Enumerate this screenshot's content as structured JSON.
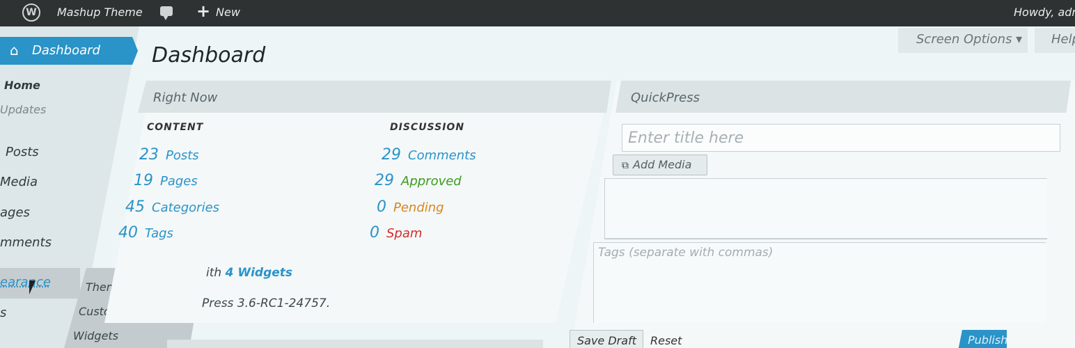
{
  "admin_bar": {
    "site_name": "Mashup Theme",
    "new_label": "New",
    "greeting": "Howdy, adm"
  },
  "sidebar": {
    "dashboard_label": "Dashboard",
    "submenu": [
      "Home",
      "Updates"
    ],
    "items": [
      "Posts",
      "Media",
      "ages",
      "mments",
      "earance",
      "s"
    ],
    "flyout": [
      "Themes",
      "Customize",
      "Widgets"
    ]
  },
  "screen_options": "Screen Options ▾",
  "help": "Help",
  "page_title": "Dashboard",
  "right_now": {
    "title": "Right Now",
    "content_heading": "CONTENT",
    "discussion_heading": "DISCUSSION",
    "content": [
      {
        "count": "23",
        "label": "Posts"
      },
      {
        "count": "19",
        "label": "Pages"
      },
      {
        "count": "45",
        "label": "Categories"
      },
      {
        "count": "40",
        "label": "Tags"
      }
    ],
    "discussion": [
      {
        "count": "29",
        "label": "Comments"
      },
      {
        "count": "29",
        "label": "Approved"
      },
      {
        "count": "0",
        "label": "Pending"
      },
      {
        "count": "0",
        "label": "Spam"
      }
    ],
    "widgets_prefix": "ith",
    "widgets_link": "4 Widgets",
    "version_text": "Press 3.6-RC1-24757."
  },
  "quickpress": {
    "title": "QuickPress",
    "title_placeholder": "Enter title here",
    "add_media": "Add Media",
    "tags_placeholder": "Tags (separate with commas)",
    "save_draft": "Save Draft",
    "reset": "Reset",
    "publish": "Publish"
  },
  "colors": {
    "accent": "#2a93c8",
    "approved": "#3d9a1e",
    "pending": "#d9861d",
    "spam": "#d62b2b",
    "admin_bar": "#2f3232"
  }
}
